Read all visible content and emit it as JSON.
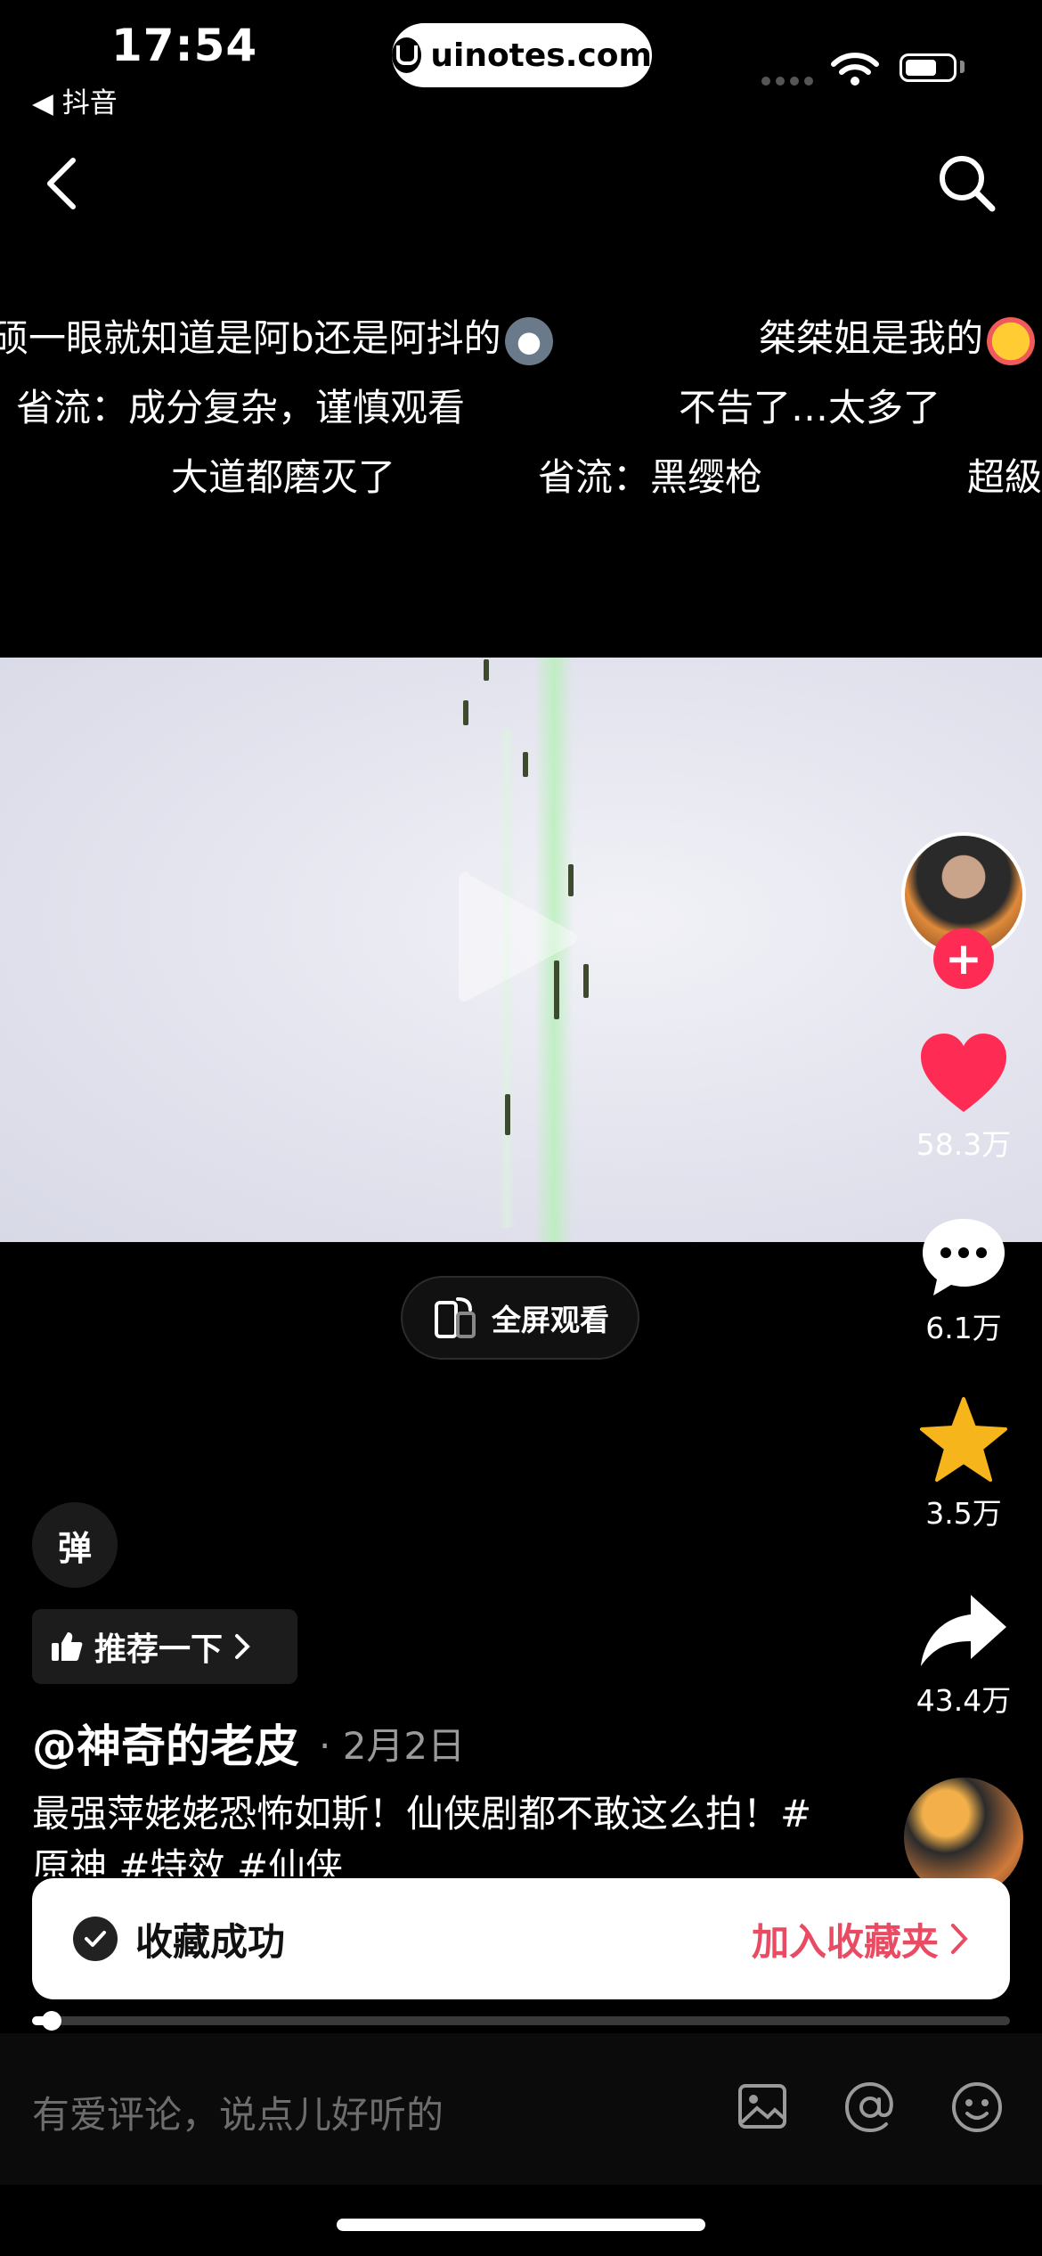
{
  "status_bar": {
    "time": "17:54",
    "back_app": "◀ 抖音",
    "site": "uinotes.com"
  },
  "danmaku": [
    {
      "text": "硕一眼就知道是阿b还是阿抖的",
      "emoji": "husky"
    },
    {
      "text": "桀桀姐是我的",
      "emoji": "heart-eyes"
    },
    {
      "text": "省流：成分复杂，谨慎观看"
    },
    {
      "text": "不告了…太多了"
    },
    {
      "text": "大道都磨灭了"
    },
    {
      "text": "省流：黑缨枪"
    },
    {
      "text": "超級"
    }
  ],
  "fullscreen_label": "全屏观看",
  "rail": {
    "likes": "58.3万",
    "comments": "6.1万",
    "favorites": "3.5万",
    "shares": "43.4万"
  },
  "danmu_toggle": "弹",
  "recommend_label": "推荐一下",
  "author": "@神奇的老皮",
  "date": "· 2月2日",
  "caption": "最强萍姥姥恐怖如斯！仙侠剧都不敢这么拍！#原神 #特效 #仙侠",
  "toast": {
    "message": "收藏成功",
    "action": "加入收藏夹"
  },
  "progress": 0.02,
  "comment_placeholder": "有爱评论，说点儿好听的",
  "colors": {
    "accent": "#fe2c55",
    "toast_action": "#e94b63",
    "star": "#f7b51c"
  }
}
